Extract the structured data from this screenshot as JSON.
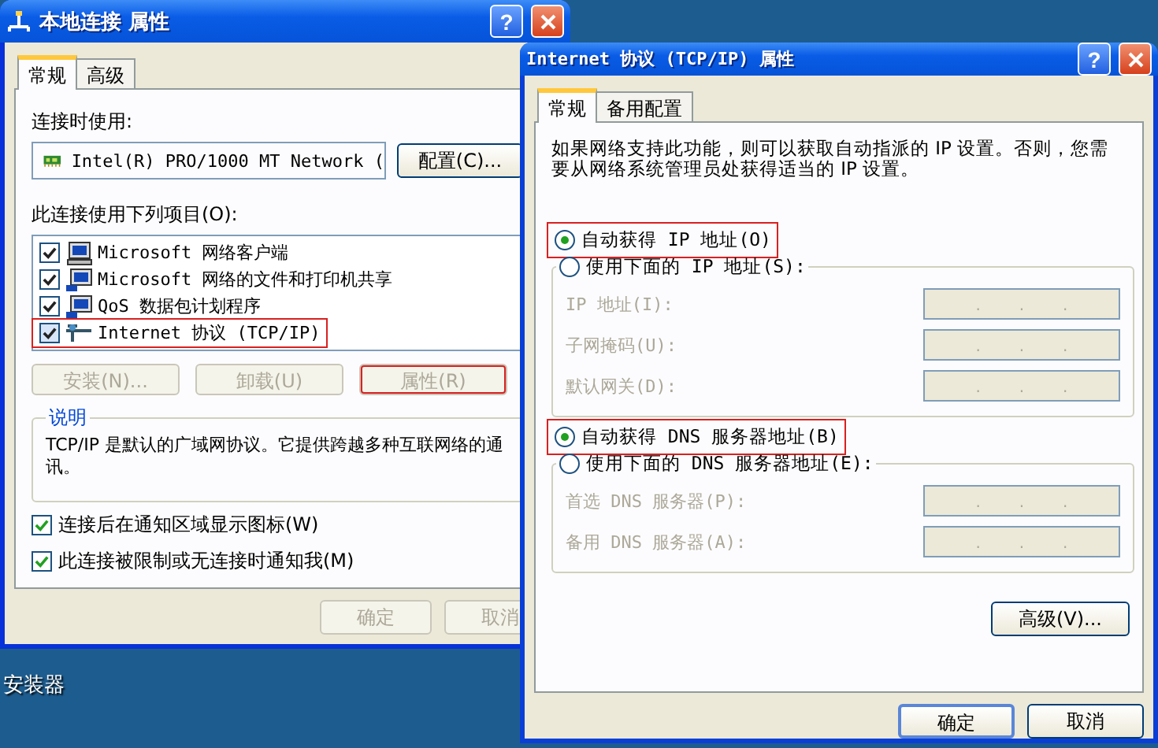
{
  "desktop": {
    "icon_label": "安装器"
  },
  "back_window": {
    "title": "本地连接 属性",
    "help_button": "?",
    "tabs": [
      {
        "label": "常规",
        "selected": true
      },
      {
        "label": "高级",
        "selected": false
      }
    ],
    "connect_using_label": "连接时使用:",
    "adapter": "Intel(R) PRO/1000 MT Network (",
    "configure_button": "配置(C)...",
    "components_label": "此连接使用下列项目(O):",
    "components": [
      {
        "label": "Microsoft 网络客户端",
        "checked": true,
        "highlighted": false,
        "kind": "client"
      },
      {
        "label": "Microsoft 网络的文件和打印机共享",
        "checked": true,
        "highlighted": false,
        "kind": "service"
      },
      {
        "label": "QoS 数据包计划程序",
        "checked": true,
        "highlighted": false,
        "kind": "service"
      },
      {
        "label": "Internet 协议 (TCP/IP)",
        "checked": true,
        "highlighted": true,
        "kind": "protocol"
      }
    ],
    "action_buttons": [
      {
        "label": "安装(N)...",
        "disabled": true,
        "highlighted": false
      },
      {
        "label": "卸载(U)",
        "disabled": true,
        "highlighted": false
      },
      {
        "label": "属性(R)",
        "disabled": true,
        "highlighted": true
      }
    ],
    "description": {
      "title": "说明",
      "text": "TCP/IP 是默认的广域网协议。它提供跨越多种互联网络的通讯。"
    },
    "options": [
      {
        "label": "连接后在通知区域显示图标(W)",
        "checked": true
      },
      {
        "label": "此连接被限制或无连接时通知我(M)",
        "checked": true
      }
    ],
    "buttons": [
      {
        "label": "确定",
        "disabled": true
      },
      {
        "label": "取消",
        "disabled": true
      }
    ]
  },
  "front_window": {
    "title": "Internet 协议 (TCP/IP) 属性",
    "help_button": "?",
    "tabs": [
      {
        "label": "常规",
        "selected": true
      },
      {
        "label": "备用配置",
        "selected": false
      }
    ],
    "intro": "如果网络支持此功能，则可以获取自动指派的 IP 设置。否则，您需要从网络系统管理员处获得适当的 IP 设置。",
    "sections": [
      {
        "auto_option": {
          "label": "自动获得 IP 地址(O)",
          "selected": true,
          "highlighted": true
        },
        "manual_option": {
          "label": "使用下面的 IP 地址(S):",
          "selected": false
        },
        "fields": [
          {
            "label": "IP 地址(I):"
          },
          {
            "label": "子网掩码(U):"
          },
          {
            "label": "默认网关(D):"
          }
        ]
      },
      {
        "auto_option": {
          "label": "自动获得 DNS 服务器地址(B)",
          "selected": true,
          "highlighted": true
        },
        "manual_option": {
          "label": "使用下面的 DNS 服务器地址(E):",
          "selected": false
        },
        "fields": [
          {
            "label": "首选 DNS 服务器(P):"
          },
          {
            "label": "备用 DNS 服务器(A):"
          }
        ]
      }
    ],
    "field_separator": ".",
    "advanced_button": "高级(V)...",
    "buttons": [
      {
        "label": "确定",
        "highlighted": true
      },
      {
        "label": "取消",
        "highlighted": false
      }
    ]
  }
}
